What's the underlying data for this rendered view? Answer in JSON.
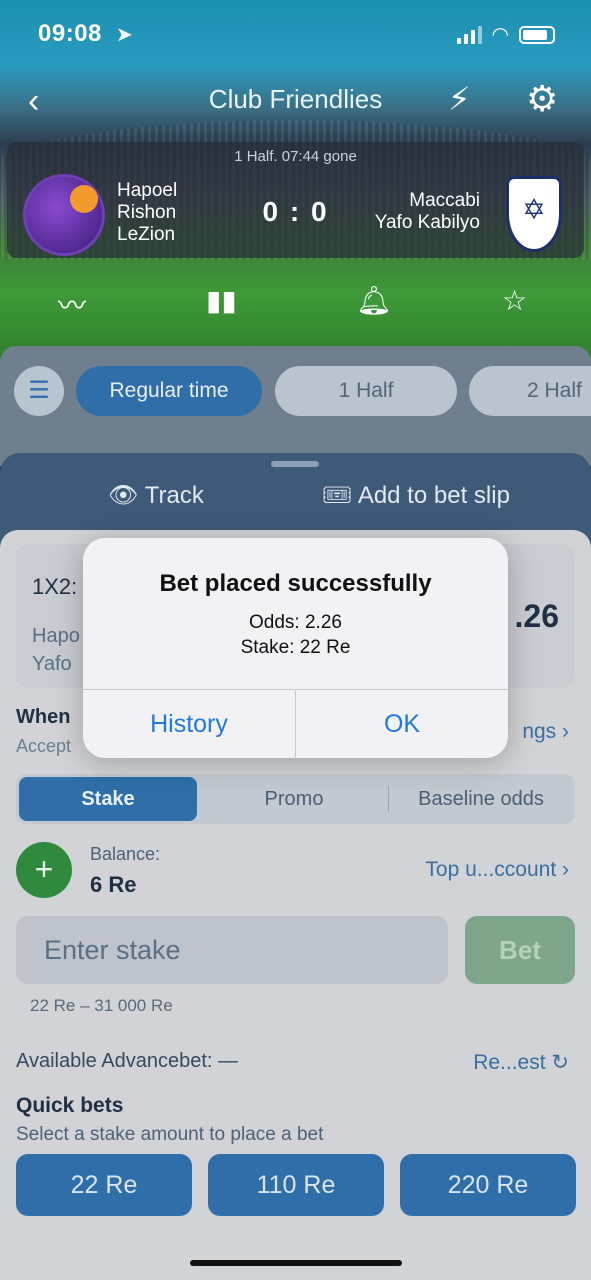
{
  "status_bar": {
    "time": "09:08"
  },
  "nav": {
    "title": "Club Friendlies"
  },
  "match": {
    "time_text": "1 Half. 07:44 gone",
    "home_team": "Hapoel Rishon LeZion",
    "home_lines": [
      "Hapoel",
      "Rishon",
      "LeZion"
    ],
    "away_lines": [
      "Maccabi",
      "Yafo Kabilyo"
    ],
    "score": "0 : 0"
  },
  "market_tabs": {
    "active": "Regular time",
    "tab1": "1 Half",
    "tab2": "2 Half"
  },
  "sheet": {
    "track": "Track",
    "add_to_slip": "Add to bet slip",
    "market": "1X2:",
    "teams_line1": "Hapo",
    "teams_line2": "Yafo",
    "odds": ".26",
    "when_label": "When",
    "accept_label": "Accept",
    "settings_link": "ngs ›",
    "segments": [
      "Stake",
      "Promo",
      "Baseline odds"
    ],
    "balance_label": "Balance:",
    "balance_value": "6 Re",
    "topup_link": "Top u...ccount ›",
    "stake_placeholder": "Enter stake",
    "bet_button": "Bet",
    "range": "22 Re – 31 000 Re",
    "advancebet": "Available Advancebet: —",
    "refresh_link": "Re...est ↻",
    "quick_title": "Quick bets",
    "quick_sub": "Select a stake amount to place a bet",
    "quick_amounts": [
      "22 Re",
      "110 Re",
      "220 Re"
    ]
  },
  "alert": {
    "title": "Bet placed successfully",
    "odds_line": "Odds: 2.26",
    "stake_line": "Stake: 22 Re",
    "left_button": "History",
    "right_button": "OK"
  },
  "colors": {
    "accent": "#2f6ea8",
    "link": "#1f7ae0",
    "success": "#2f8a3e"
  },
  "icons": [
    "location-arrow-icon",
    "signal-icon",
    "wifi-icon",
    "battery-icon",
    "back-chevron-icon",
    "lightning-icon",
    "gear-icon",
    "chart-line-icon",
    "stats-bars-icon",
    "bell-icon",
    "star-icon",
    "list-icon",
    "track-icon",
    "ticket-icon",
    "plus-icon",
    "refresh-icon"
  ]
}
